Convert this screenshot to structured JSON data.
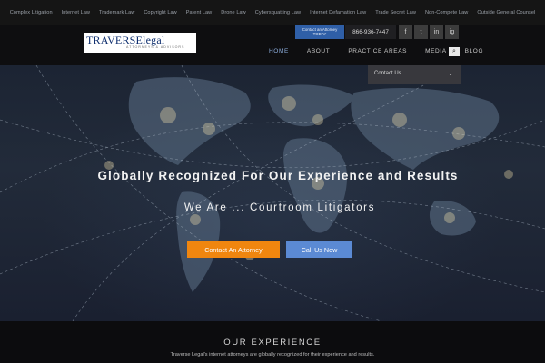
{
  "topbar": {
    "links": [
      "Complex Litigation",
      "Internet Law",
      "Trademark Law",
      "Copyright Law",
      "Patent Law",
      "Drone Law",
      "Cybersquatting Law",
      "Internet Defamation Law",
      "Trade Secret Law",
      "Non-Compete Law",
      "Outside General Counsel"
    ]
  },
  "header": {
    "logo_name": "TRAVERSElegal",
    "logo_tagline": "ATTORNEYS & ADVISORS",
    "contact_mini": "Contact an Attorney TODAY",
    "phone": "866-936-7447",
    "social": [
      "f",
      "t",
      "in",
      "ig"
    ]
  },
  "nav": {
    "items": [
      "HOME",
      "ABOUT",
      "PRACTICE AREAS",
      "MEDIA",
      "BLOG"
    ],
    "active": "HOME"
  },
  "dropdown": {
    "label": "Contact Us"
  },
  "hero": {
    "headline": "Globally Recognized For Our Experience and Results",
    "subline": "We Are ... Courtroom Litigators",
    "contact_button": "Contact An Attorney",
    "call_button": "Call Us Now"
  },
  "section": {
    "title": "OUR EXPERIENCE",
    "text": "Traverse Legal's internet attorneys are globally recognized for their experience and results."
  },
  "colors": {
    "accent_orange": "#f0860f",
    "accent_blue": "#5b8ad4",
    "contact_blue": "#2f5fa7"
  }
}
